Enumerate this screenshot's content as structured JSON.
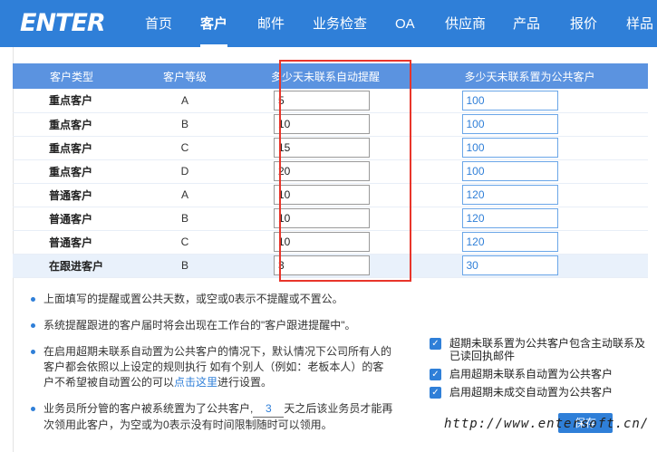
{
  "brand": {
    "logo_text": "ENTER"
  },
  "nav": {
    "items": [
      {
        "label": "首页",
        "active": false
      },
      {
        "label": "客户",
        "active": true
      },
      {
        "label": "邮件",
        "active": false
      },
      {
        "label": "业务检查",
        "active": false
      },
      {
        "label": "OA",
        "active": false
      },
      {
        "label": "供应商",
        "active": false
      },
      {
        "label": "产品",
        "active": false
      },
      {
        "label": "报价",
        "active": false
      },
      {
        "label": "样品",
        "active": false
      }
    ]
  },
  "table": {
    "headers": [
      "客户类型",
      "客户等级",
      "多少天未联系自动提醒",
      "多少天未联系置为公共客户"
    ],
    "rows": [
      {
        "type": "重点客户",
        "level": "A",
        "warn_days": "5",
        "public_days": "100"
      },
      {
        "type": "重点客户",
        "level": "B",
        "warn_days": "10",
        "public_days": "100"
      },
      {
        "type": "重点客户",
        "level": "C",
        "warn_days": "15",
        "public_days": "100"
      },
      {
        "type": "重点客户",
        "level": "D",
        "warn_days": "20",
        "public_days": "100"
      },
      {
        "type": "普通客户",
        "level": "A",
        "warn_days": "10",
        "public_days": "120"
      },
      {
        "type": "普通客户",
        "level": "B",
        "warn_days": "10",
        "public_days": "120"
      },
      {
        "type": "普通客户",
        "level": "C",
        "warn_days": "10",
        "public_days": "120"
      },
      {
        "type": "在跟进客户",
        "level": "B",
        "warn_days": "3",
        "public_days": "30"
      }
    ]
  },
  "notes": {
    "n1": "上面填写的提醒或置公共天数，或空或0表示不提醒或不置公。",
    "n2": "系统提醒跟进的客户届时将会出现在工作台的\"客户跟进提醒中\"。",
    "n3_before": "在启用超期未联系自动置为公共客户的情况下，默认情况下公司所有人的客户都会依照以上设定的规则执行 如有个别人（例如：老板本人）的客户不希望被自动置公的可以",
    "n3_link": "点击这里",
    "n3_after": "进行设置。",
    "n4_before": "业务员所分管的客户被系统置为了公共客户,",
    "n4_days": "3",
    "n4_after": "天之后该业务员才能再次领用此客户，为空或为0表示没有时间限制随时可以领用。"
  },
  "options": [
    {
      "label": "超期未联系置为公共客户包含主动联系及已读回执邮件",
      "checked": true
    },
    {
      "label": "启用超期未联系自动置为公共客户",
      "checked": true
    },
    {
      "label": "启用超期未成交自动置为公共客户",
      "checked": true
    }
  ],
  "save_label": "保存",
  "watermark": "http://www.entersoft.cn/",
  "colors": {
    "brand": "#2f7fd8",
    "header": "#5b93e0",
    "highlight_box": "#e8352a"
  }
}
